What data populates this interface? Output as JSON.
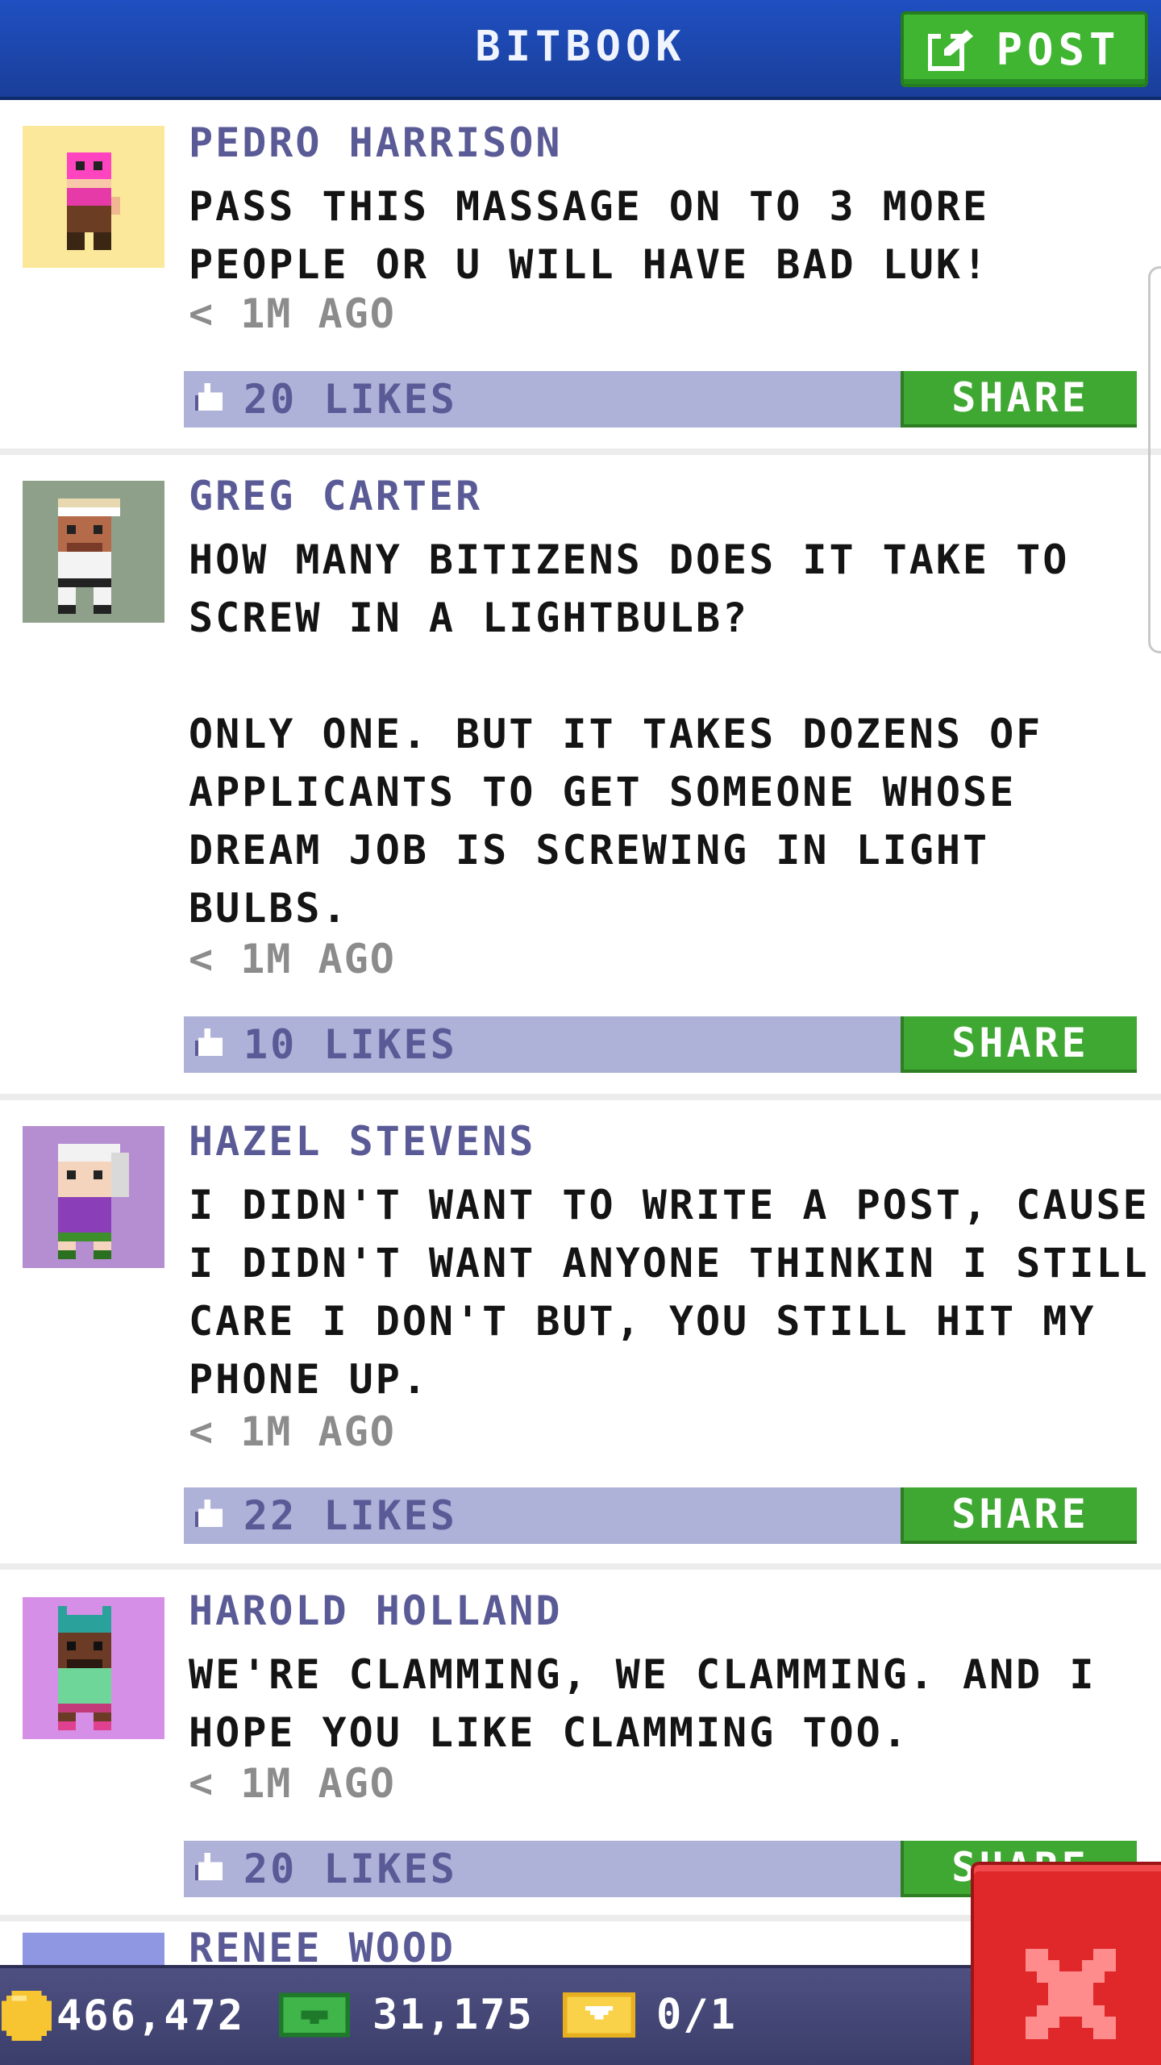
{
  "header": {
    "title": "BITBOOK",
    "post_label": "POST"
  },
  "posts": [
    {
      "author": "PEDRO HARRISON",
      "text": "PASS THIS MASSAGE ON TO 3 MORE\nPEOPLE OR U WILL HAVE BAD LUK!",
      "time": "< 1M AGO",
      "likes": "20 LIKES",
      "share_label": "SHARE",
      "avatar_bg": "#fbe89a"
    },
    {
      "author": "GREG CARTER",
      "text": "HOW MANY BITIZENS DOES IT TAKE TO\nSCREW IN A LIGHTBULB?\n\nONLY ONE. BUT IT TAKES DOZENS OF\nAPPLICANTS TO GET SOMEONE WHOSE\nDREAM JOB IS SCREWING IN LIGHT\nBULBS.",
      "time": "< 1M AGO",
      "likes": "10 LIKES",
      "share_label": "SHARE",
      "avatar_bg": "#8fa08a"
    },
    {
      "author": "HAZEL STEVENS",
      "text": "I DIDN'T WANT TO WRITE A POST, CAUSE\nI DIDN'T WANT ANYONE THINKIN I STILL\nCARE I DON'T BUT, YOU STILL HIT MY\nPHONE UP.",
      "time": "< 1M AGO",
      "likes": "22 LIKES",
      "share_label": "SHARE",
      "avatar_bg": "#b48ed0"
    },
    {
      "author": "HAROLD HOLLAND",
      "text": "WE'RE CLAMMING, WE CLAMMING. AND I\nHOPE YOU LIKE CLAMMING TOO.",
      "time": "< 1M AGO",
      "likes": "20 LIKES",
      "share_label": "SHARE",
      "avatar_bg": "#d58fe6"
    },
    {
      "author": "RENEE WOOD",
      "avatar_bg": "#8f97e2"
    }
  ],
  "bottom_bar": {
    "coins": "466,472",
    "bux": "31,175",
    "tickets": "0/1"
  },
  "colors": {
    "header_blue": "#1f4fc1",
    "post_green": "#3fb531",
    "likes_bar": "#aeb1d8",
    "close_red": "#e0282a",
    "author_purple": "#5a5a96"
  }
}
